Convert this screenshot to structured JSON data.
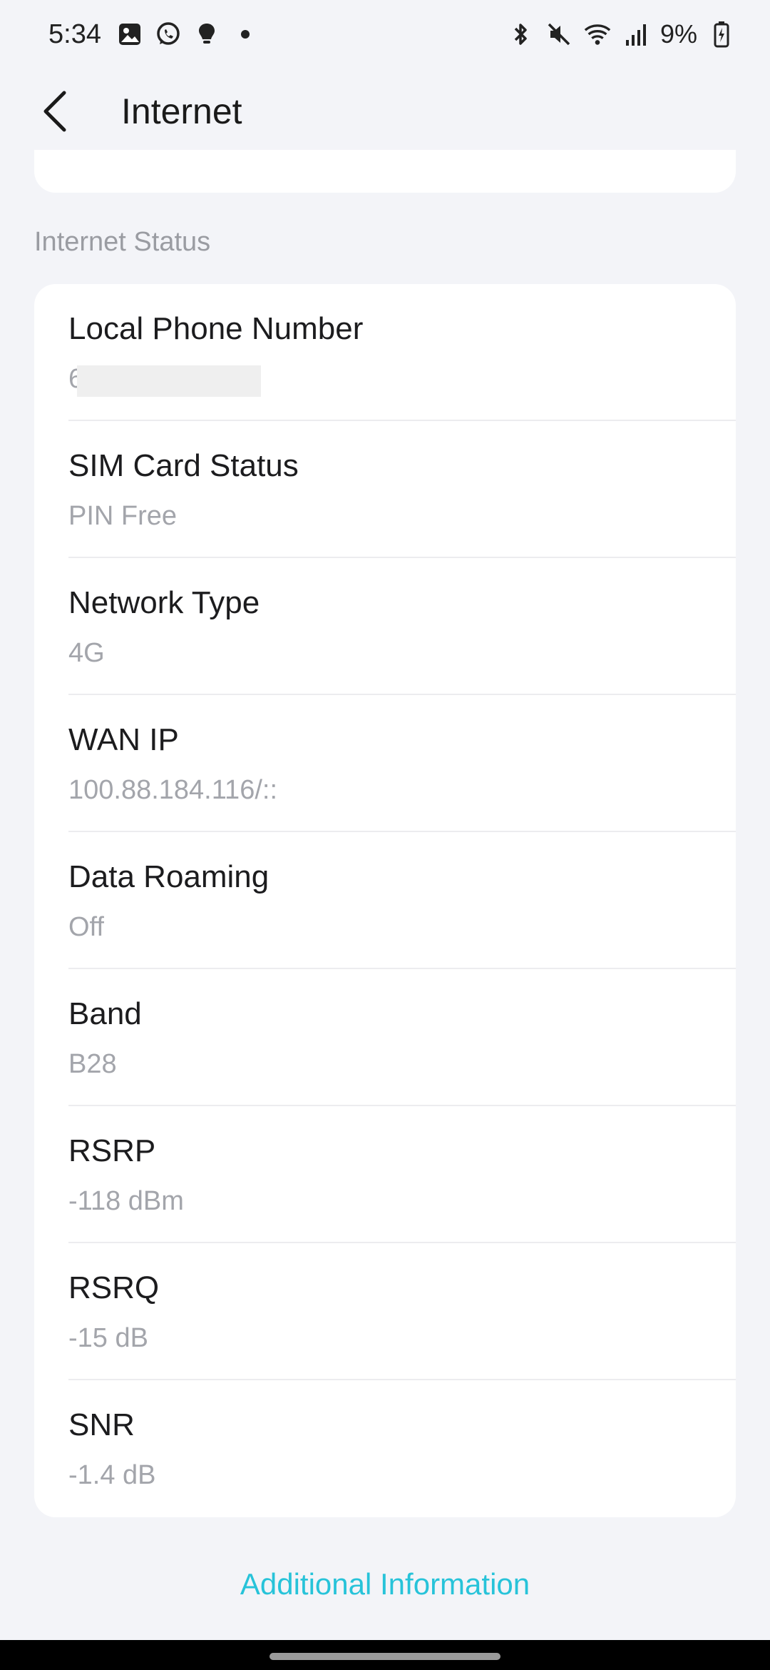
{
  "status_bar": {
    "time": "5:34",
    "battery": "9%",
    "icons": [
      "gallery-icon",
      "whatsapp-icon",
      "bulb-icon",
      "dot-icon",
      "bluetooth-icon",
      "mute-icon",
      "wifi-icon",
      "signal-icon",
      "battery-icon"
    ]
  },
  "header": {
    "title": "Internet",
    "back_icon": "chevron-left-icon"
  },
  "section": {
    "label": "Internet Status"
  },
  "rows": [
    {
      "label": "Local Phone Number",
      "value": "6"
    },
    {
      "label": "SIM Card Status",
      "value": "PIN Free"
    },
    {
      "label": "Network Type",
      "value": "4G"
    },
    {
      "label": "WAN IP",
      "value": "100.88.184.116/::"
    },
    {
      "label": "Data Roaming",
      "value": "Off"
    },
    {
      "label": "Band",
      "value": "B28"
    },
    {
      "label": "RSRP",
      "value": "-118 dBm"
    },
    {
      "label": "RSRQ",
      "value": "-15 dB"
    },
    {
      "label": "SNR",
      "value": "-1.4 dB"
    }
  ],
  "footer": {
    "link": "Additional Information"
  },
  "colors": {
    "accent": "#27c3d9",
    "background": "#f3f4f8",
    "card": "#ffffff",
    "muted_text": "#a3a5ab"
  }
}
